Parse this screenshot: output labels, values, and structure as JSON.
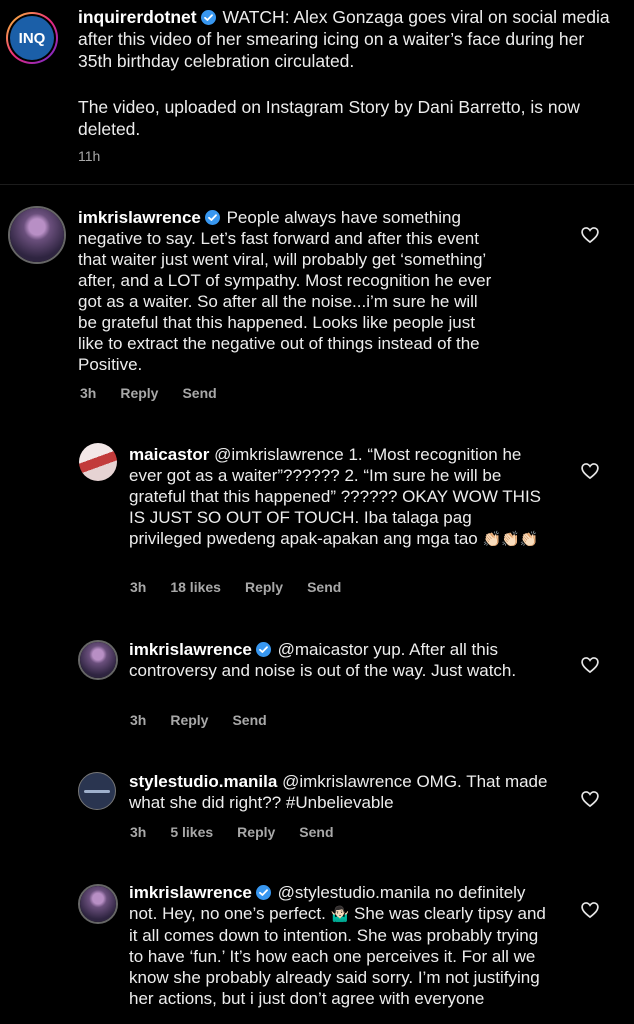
{
  "caption": {
    "username": "inquirerdotnet",
    "avatar_text": "INQ",
    "text_line1": "WATCH: Alex Gonzaga goes viral on social media after this video of her smearing icing on a waiter’s face during her 35th birthday celebration circulated.",
    "text_line2": "The video, uploaded on Instagram Story by Dani Barretto, is now deleted.",
    "time": "11h"
  },
  "comments": [
    {
      "username": "imkrislawrence",
      "verified": true,
      "text": "People always have something negative to say. Let’s fast forward and after this event that waiter just went viral, will probably get ‘something’ after, and a LOT of sympathy. Most recognition he ever got as a waiter. So after all the noise...i’m sure he will be grateful that this happened. Looks like people just like to extract the negative out of things instead of the Positive.",
      "time": "3h",
      "likes": "",
      "reply": "Reply",
      "send": "Send"
    },
    {
      "username": "maicastor",
      "verified": false,
      "text": "@imkrislawrence 1. “Most recognition he ever got as a waiter”?????? 2. “Im sure he will be grateful that this happened” ?????? OKAY WOW THIS IS JUST SO OUT OF TOUCH. Iba talaga pag privileged pwedeng apak-apakan ang mga tao",
      "emoji": "👏🏻👏🏻👏🏻",
      "time": "3h",
      "likes": "18 likes",
      "reply": "Reply",
      "send": "Send"
    },
    {
      "username": "imkrislawrence",
      "verified": true,
      "text": "@maicastor yup. After all this controversy and noise is out of the way. Just watch.",
      "time": "3h",
      "likes": "",
      "reply": "Reply",
      "send": "Send"
    },
    {
      "username": "stylestudio.manila",
      "verified": false,
      "text": "@imkrislawrence OMG. That made what she did right?? #Unbelievable",
      "time": "3h",
      "likes": "5 likes",
      "reply": "Reply",
      "send": "Send"
    },
    {
      "username": "imkrislawrence",
      "verified": true,
      "text_a": "@stylestudio.manila no definitely not. Hey, no one’s perfect.",
      "emoji": "🤷🏻‍♂️",
      "text_b": "She was clearly tipsy and it all comes down to intention. She was probably trying to have ‘fun.’ It’s how each one perceives it. For all we know she probably already said sorry. I’m not justifying her actions, but i just don’t agree with everyone",
      "time": "",
      "likes": "",
      "reply": "",
      "send": ""
    }
  ],
  "colors": {
    "background": "#000000",
    "verified": "#3897f0",
    "meta_text": "#a8a8a8",
    "inq_blue": "#1b5fa8"
  },
  "icons": [
    "verified-badge-icon",
    "heart-icon"
  ]
}
